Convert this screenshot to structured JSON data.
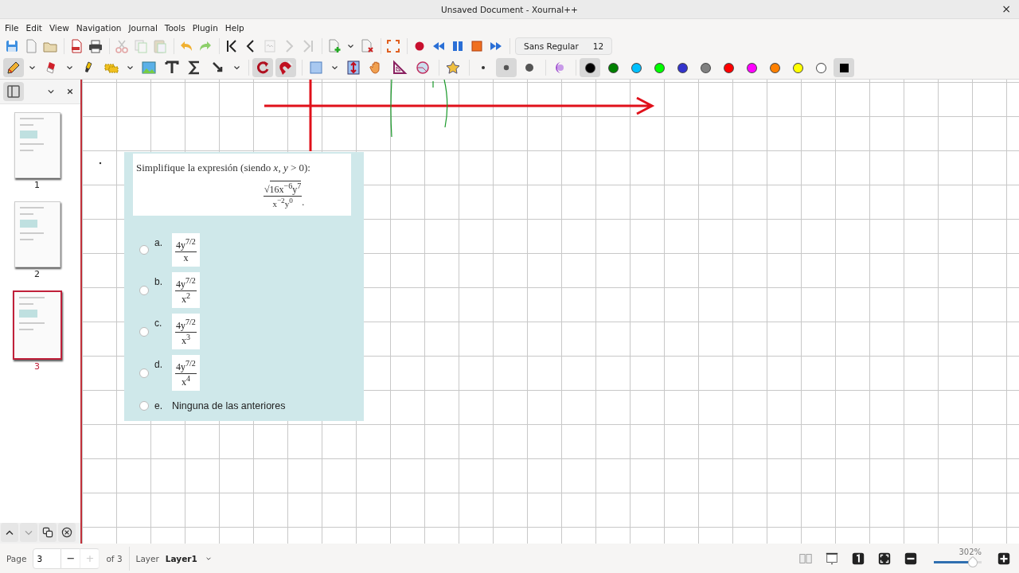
{
  "window": {
    "title": "Unsaved Document - Xournal++",
    "close": "×"
  },
  "menu": [
    "File",
    "Edit",
    "View",
    "Navigation",
    "Journal",
    "Tools",
    "Plugin",
    "Help"
  ],
  "main_toolbar": [
    [
      {
        "kind": "save",
        "disabled": false
      },
      {
        "kind": "new",
        "disabled": false
      },
      {
        "kind": "open",
        "disabled": false
      }
    ],
    [
      {
        "kind": "export-pdf",
        "disabled": false
      },
      {
        "kind": "print",
        "disabled": false
      }
    ],
    [
      {
        "kind": "cut",
        "disabled": true
      },
      {
        "kind": "copy",
        "disabled": true
      },
      {
        "kind": "paste",
        "disabled": true
      }
    ],
    [
      {
        "kind": "undo",
        "disabled": false
      },
      {
        "kind": "redo",
        "disabled": false
      }
    ],
    [
      {
        "kind": "first",
        "disabled": false
      },
      {
        "kind": "prev",
        "disabled": false
      },
      {
        "kind": "goto",
        "disabled": true
      },
      {
        "kind": "next",
        "disabled": true
      },
      {
        "kind": "last",
        "disabled": true
      }
    ],
    [
      {
        "kind": "add-page",
        "disabled": false
      },
      {
        "kind": "dropdown",
        "disabled": false
      },
      {
        "kind": "delete-page",
        "disabled": false
      }
    ],
    [
      {
        "kind": "fullscreen",
        "disabled": false
      }
    ],
    [
      {
        "kind": "record",
        "disabled": false
      },
      {
        "kind": "rewind",
        "disabled": false
      },
      {
        "kind": "pause",
        "disabled": false
      },
      {
        "kind": "stop",
        "disabled": false
      },
      {
        "kind": "forward",
        "disabled": false
      }
    ]
  ],
  "font_button": {
    "font": "Sans Regular",
    "size": "12"
  },
  "tools_toolbar": [
    [
      {
        "kind": "pen",
        "selected": true
      },
      {
        "kind": "dropdown",
        "selected": false
      },
      {
        "kind": "eraser",
        "selected": false
      },
      {
        "kind": "dropdown",
        "selected": false
      },
      {
        "kind": "highlighter",
        "selected": false
      },
      {
        "kind": "select-region",
        "selected": false
      },
      {
        "kind": "dropdown",
        "selected": false
      },
      {
        "kind": "image",
        "selected": false
      },
      {
        "kind": "text",
        "selected": false
      },
      {
        "kind": "tex",
        "selected": false
      },
      {
        "kind": "select-object",
        "selected": false
      },
      {
        "kind": "dropdown",
        "selected": false
      }
    ],
    [
      {
        "kind": "rotation-snap",
        "selected": true
      },
      {
        "kind": "grid-snap",
        "selected": true
      }
    ],
    [
      {
        "kind": "shape",
        "selected": false
      },
      {
        "kind": "dropdown",
        "selected": false
      },
      {
        "kind": "vertical-space",
        "selected": false
      },
      {
        "kind": "hand",
        "selected": false
      },
      {
        "kind": "setsquare",
        "selected": false
      },
      {
        "kind": "compass",
        "selected": false
      }
    ],
    [
      {
        "kind": "star",
        "selected": false
      }
    ]
  ],
  "pen_sizes": [
    {
      "kind": "fine",
      "selected": false
    },
    {
      "kind": "medium",
      "selected": true
    },
    {
      "kind": "thick",
      "selected": false
    }
  ],
  "colors": [
    {
      "color": "#000000",
      "selected": true
    },
    {
      "color": "#008000",
      "selected": false
    },
    {
      "color": "#00c0ff",
      "selected": false
    },
    {
      "color": "#00ff00",
      "selected": false
    },
    {
      "color": "#3333cc",
      "selected": false
    },
    {
      "color": "#808080",
      "selected": false
    },
    {
      "color": "#ff0000",
      "selected": false
    },
    {
      "color": "#ff00ff",
      "selected": false
    },
    {
      "color": "#ff8000",
      "selected": false
    },
    {
      "color": "#ffff00",
      "selected": false
    },
    {
      "color": "#ffffff",
      "selected": false
    }
  ],
  "custom_color": {
    "selected": true
  },
  "sidebar": {
    "pages": [
      {
        "label": "1",
        "selected": false
      },
      {
        "label": "2",
        "selected": false
      },
      {
        "label": "3",
        "selected": true
      }
    ]
  },
  "quiz": {
    "question": "Simplifique la expresión (siendo *x*, *y* > 0):",
    "radical": "√",
    "radicand": "16x$^{−6}$y$^{7}$",
    "denominator": "x$^{−2}$y$^{0}$",
    "period": ".",
    "options": [
      {
        "letter": "a.",
        "kind": "fraction",
        "numerator": "4y$^{7/2}$",
        "denominator": "x",
        "checked": false
      },
      {
        "letter": "b.",
        "kind": "fraction",
        "numerator": "4y$^{7/2}$",
        "denominator": "x$^{2}$",
        "checked": false
      },
      {
        "letter": "c.",
        "kind": "fraction",
        "numerator": "4y$^{7/2}$",
        "denominator": "x$^{3}$",
        "checked": false
      },
      {
        "letter": "d.",
        "kind": "fraction",
        "numerator": "4y$^{7/2}$",
        "denominator": "x$^{4}$",
        "checked": false
      },
      {
        "letter": "e.",
        "kind": "text",
        "text": "Ninguna de las anteriores",
        "checked": false
      }
    ]
  },
  "status_bar": {
    "page_label": "Page",
    "page": "3",
    "minus": "−",
    "plus": "+",
    "plus_disabled": true,
    "of": "of 3",
    "layer_label": "Layer",
    "layer": "Layer1",
    "zoom": "302%",
    "level": 0.83
  }
}
